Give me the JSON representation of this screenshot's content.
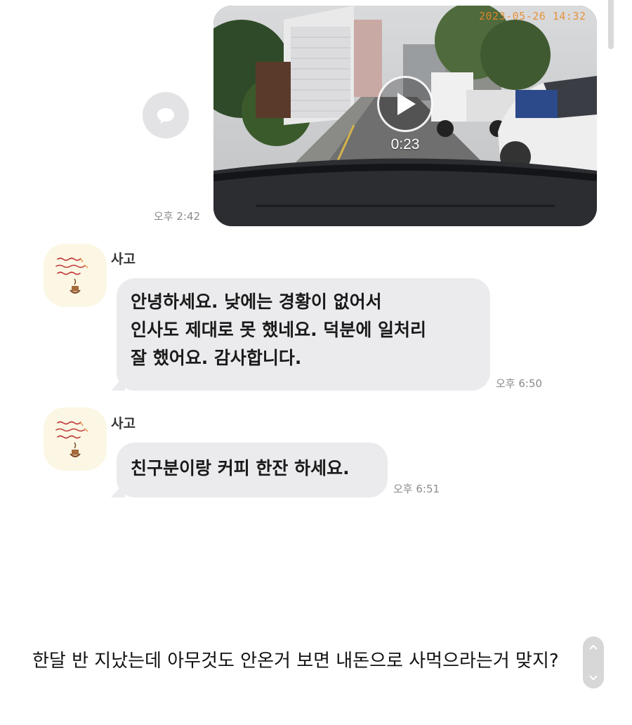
{
  "video_message": {
    "duration": "0:23",
    "timestamp": "오후 2:42",
    "camera_stamp": "2023-05-26 14:32"
  },
  "messages": [
    {
      "sender": "사고",
      "lines": [
        "안녕하세요. 낮에는 경황이 없어서",
        "인사도 제대로 못 했네요.  덕분에 일처리",
        "잘 했어요. 감사합니다."
      ],
      "time": "오후 6:50"
    },
    {
      "sender": "사고",
      "lines": [
        "친구분이랑 커피 한잔 하세요."
      ],
      "time": "오후 6:51"
    }
  ],
  "caption": "한달 반 지났는데 아무것도 안온거 보면 내돈으로 사먹으라는거 맞지?",
  "icons": {
    "share": "share-icon",
    "play": "play-icon",
    "scroll_up": "chevron-up-icon",
    "scroll_down": "chevron-down-icon"
  },
  "colors": {
    "bubble": "#ebebee",
    "avatar_bg": "#fbf7e4",
    "timestamp": "#8a8a8a",
    "camera_stamp": "#e88a2a"
  }
}
